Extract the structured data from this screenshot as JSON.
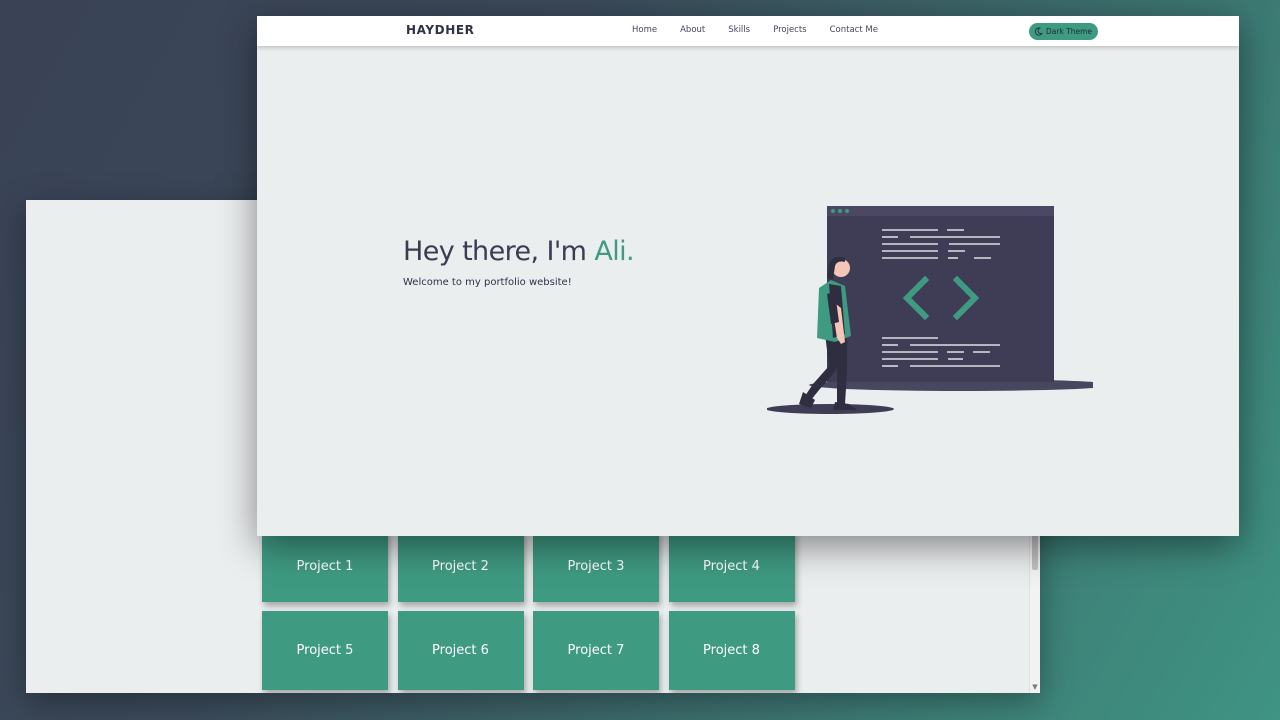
{
  "back_window": {
    "projects": [
      {
        "label": "Project 1"
      },
      {
        "label": "Project 2"
      },
      {
        "label": "Project 3"
      },
      {
        "label": "Project 4"
      },
      {
        "label": "Project 5"
      },
      {
        "label": "Project 6"
      },
      {
        "label": "Project 7"
      },
      {
        "label": "Project 8"
      }
    ]
  },
  "front_window": {
    "navbar": {
      "brand": "HAYDHER",
      "links": [
        "Home",
        "About",
        "Skills",
        "Projects",
        "Contact Me"
      ],
      "theme_toggle": {
        "icon": "moon-icon",
        "label": "Dark Theme"
      }
    },
    "hero": {
      "greeting": "Hey there, I'm ",
      "name": "Ali.",
      "subtitle": "Welcome to my portfolio website!"
    },
    "illustration": {
      "name": "developer-with-code-window-illustration"
    }
  },
  "colors": {
    "accent": "#3f9a82",
    "text_dark": "#3a3d52",
    "page_bg": "#ebeeef",
    "navbar_bg": "#ffffff",
    "code_window": "#3f3d56"
  }
}
